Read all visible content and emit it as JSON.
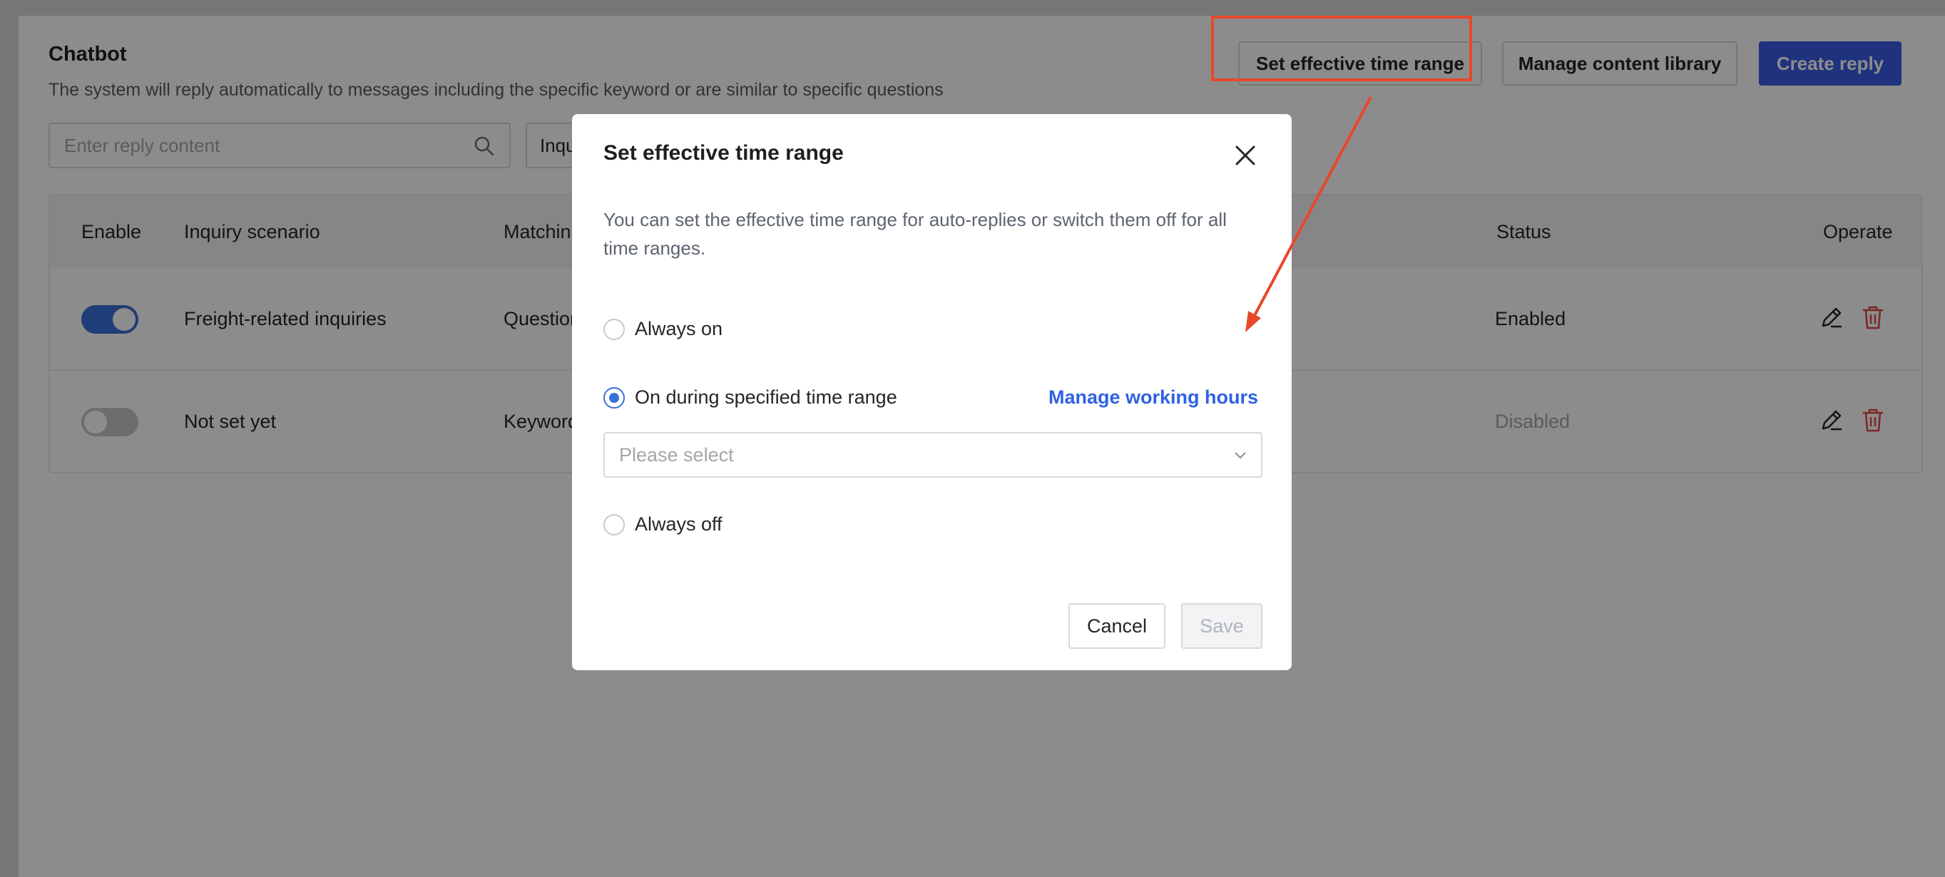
{
  "page": {
    "title": "Chatbot",
    "description": "The system will reply automatically to messages including the specific keyword or are similar to specific questions"
  },
  "toolbar": {
    "set_time_range_label": "Set effective time range",
    "manage_library_label": "Manage content library",
    "create_reply_label": "Create reply"
  },
  "search": {
    "placeholder": "Enter reply content",
    "filter_label": "Inqu"
  },
  "table": {
    "headers": {
      "enable": "Enable",
      "scenario": "Inquiry scenario",
      "matching": "Matchin",
      "status": "Status",
      "operate": "Operate"
    },
    "rows": [
      {
        "enabled": true,
        "scenario": "Freight-related inquiries",
        "matching": "Question",
        "status": "Enabled"
      },
      {
        "enabled": false,
        "scenario": "Not set yet",
        "matching": "Keyword",
        "status": "Disabled"
      }
    ]
  },
  "modal": {
    "title": "Set effective time range",
    "description": "You can set the effective time range for auto-replies or switch them off for all time ranges.",
    "options": {
      "always_on": "Always on",
      "specified": "On during specified time range",
      "always_off": "Always off"
    },
    "selected_option": "specified",
    "manage_hours_label": "Manage working hours",
    "select_placeholder": "Please select",
    "cancel_label": "Cancel",
    "save_label": "Save"
  },
  "colors": {
    "primary": "#3a5ce5",
    "link": "#2f61e3",
    "highlight": "#e8472a",
    "delete": "#e0463c"
  },
  "icons": [
    "search-icon",
    "close-icon",
    "chevron-down-icon",
    "edit-icon",
    "delete-icon"
  ]
}
